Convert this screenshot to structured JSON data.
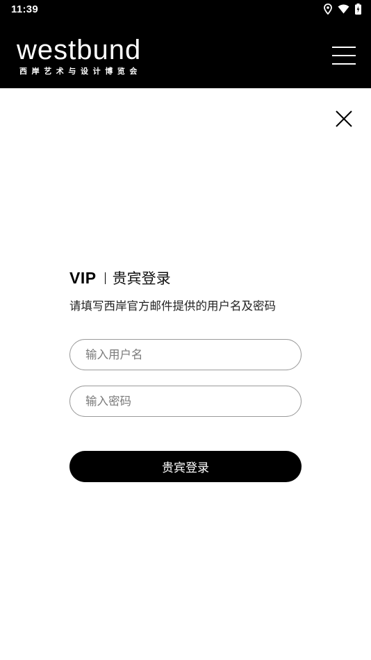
{
  "status_bar": {
    "time": "11:39",
    "icons": [
      "location-icon",
      "wifi-icon",
      "battery-charging-icon"
    ]
  },
  "header": {
    "logo_text": "westbund",
    "logo_subtitle": "西岸艺术与设计博览会",
    "menu_icon": "hamburger-menu-icon"
  },
  "close_icon": "close-icon",
  "login": {
    "prefix": "VIP",
    "title": "贵宾登录",
    "description": "请填写西岸官方邮件提供的用户名及密码",
    "username_placeholder": "输入用户名",
    "password_placeholder": "输入密码",
    "submit_label": "贵宾登录"
  },
  "colors": {
    "header_bg": "#000000",
    "page_bg": "#ffffff",
    "button_bg": "#000000",
    "input_border": "#9a9a9a"
  }
}
